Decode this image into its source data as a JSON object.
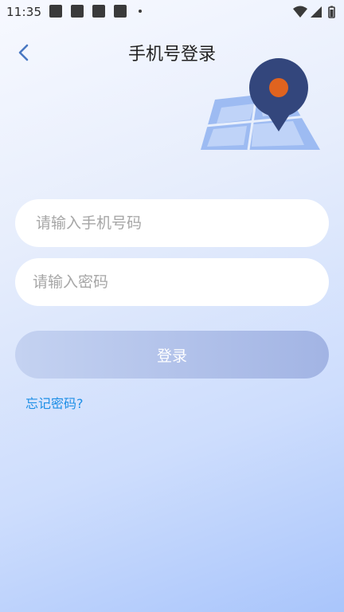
{
  "status_bar": {
    "time": "11:35",
    "notification_icons": [
      "notification-icon",
      "notification-icon",
      "notification-icon",
      "notification-icon"
    ],
    "system_icons": [
      "wifi-icon",
      "signal-icon",
      "battery-icon"
    ]
  },
  "header": {
    "back_icon": "chevron-left-icon",
    "title": "手机号登录"
  },
  "illustration": {
    "name": "map-pin-illustration",
    "pin_color": "#33467c",
    "pin_dot_color": "#e0631f",
    "map_color": "#8fb1f0"
  },
  "form": {
    "phone_placeholder": "请输入手机号码",
    "phone_value": "",
    "password_placeholder": "请输入密码",
    "password_value": "",
    "login_label": "登录",
    "forgot_label": "忘记密码?"
  },
  "colors": {
    "accent_link": "#1e8fe6",
    "button_start": "#c4d2f1",
    "button_end": "#a2b4e4"
  }
}
